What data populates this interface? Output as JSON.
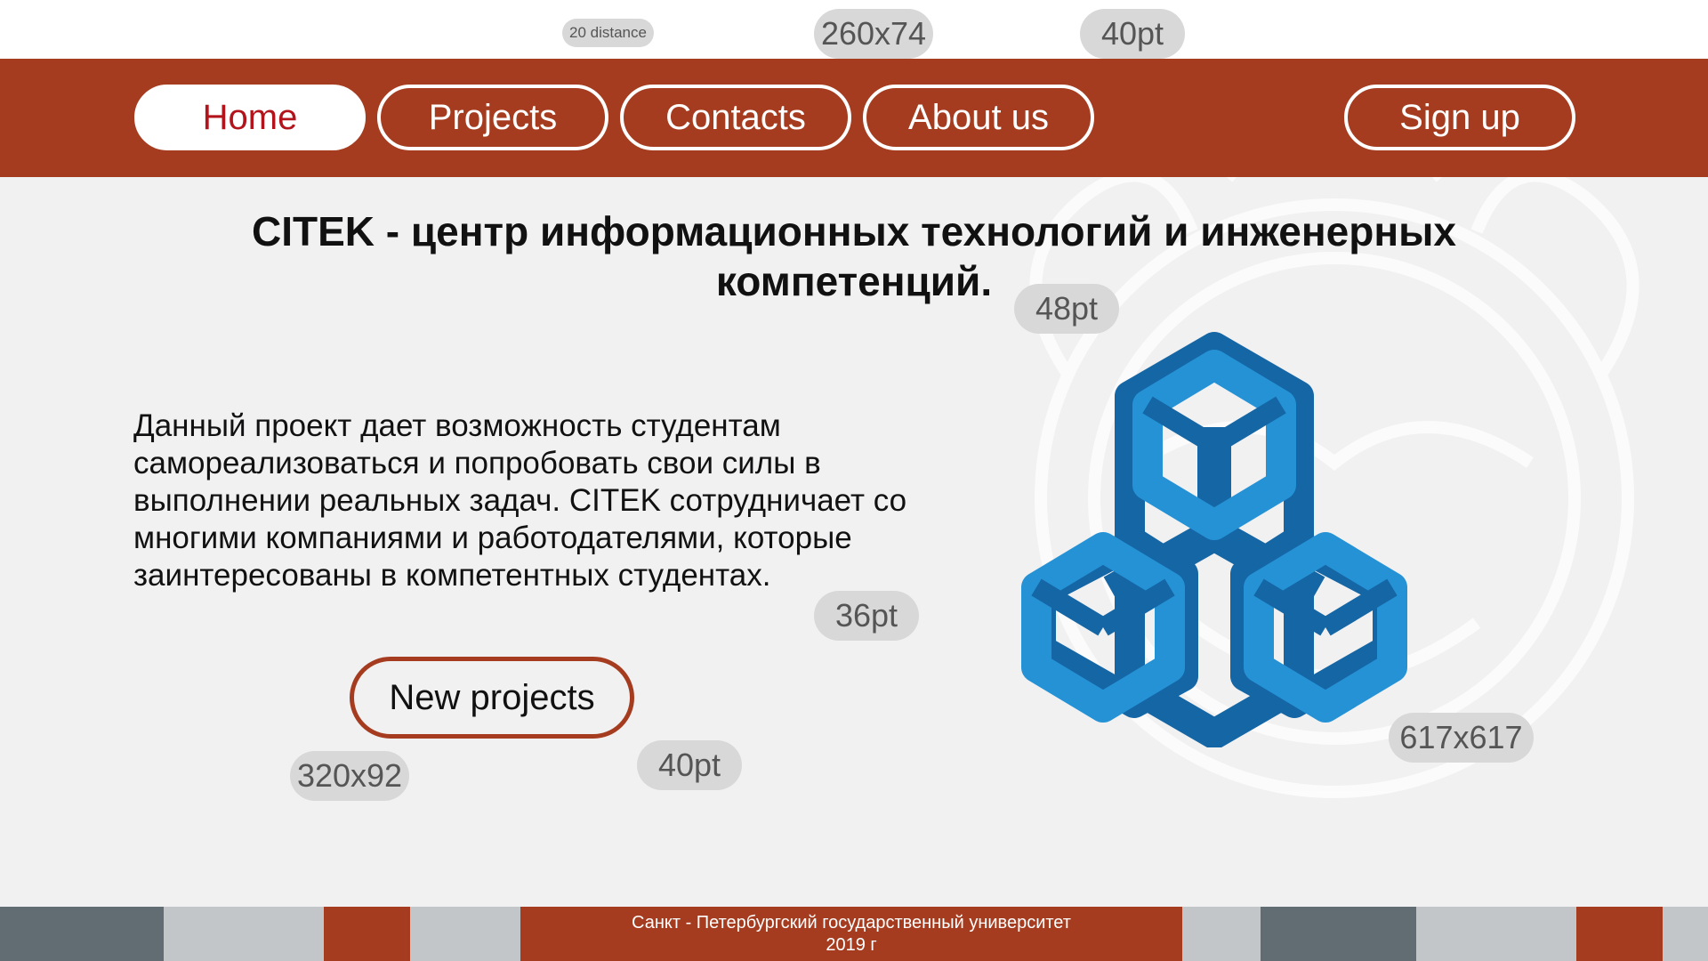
{
  "nav": {
    "items": [
      "Home",
      "Projects",
      "Contacts",
      "About us"
    ],
    "active": "Home",
    "signup_label": "Sign up"
  },
  "main": {
    "headline_line1": "CITEK - центр информационных технологий и инженерных",
    "headline_line2": "компетенций.",
    "description": "Данный проект дает возможность студентам самореализоваться и попробовать свои силы в выполнении реальных задач. CITEK сотрудничает со многими компаниями и работодателями, которые заинтересованы в компетентных студентах.",
    "cta_label": "New projects"
  },
  "annotations": {
    "distance": "20 distance",
    "nav_size": "260x74",
    "nav_font": "40pt",
    "headline_font": "48pt",
    "body_font": "36pt",
    "cta_size": "320x92",
    "cta_font": "40pt",
    "logo_size": "617x617"
  },
  "footer": {
    "line1": "Санкт - Петербургский государственный университет",
    "line2": "2019 г"
  },
  "colors": {
    "primary": "#a63c1f",
    "active_text": "#b3141c",
    "background": "#f1f1f2",
    "logo_light": "#2592d6",
    "logo_dark": "#1566a5",
    "footer_gray_dark": "#626c73",
    "footer_gray_light": "#c2c6c9"
  },
  "icons": {
    "logo": "citek-cubes-logo",
    "background": "spbu-emblem-watermark"
  }
}
